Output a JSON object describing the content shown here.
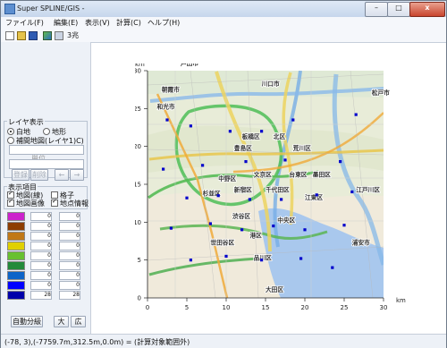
{
  "window": {
    "title": "Super SPLINE/GIS -",
    "controls": {
      "minimize": "–",
      "maximize": "□",
      "close": "x"
    }
  },
  "menu": [
    "ファイル(F)",
    "編集(E)",
    "表示(V)",
    "計算(C)",
    "ヘルプ(H)"
  ],
  "toolbar": {
    "zoom": "3兆"
  },
  "left_panel": {
    "layer_title": "レイヤ表示",
    "options": [
      "白地",
      "地形",
      "補間地図(レイヤ1)C)"
    ],
    "unit_label": "単位",
    "buttons": {
      "register": "登録",
      "delete": "削除",
      "prev": "←",
      "next": "→"
    },
    "display_title": "表示項目",
    "checkboxes": [
      "地図(線)",
      "格子",
      "地図画像",
      "地点情報"
    ],
    "legend_colors": [
      "#cc22cc",
      "#8d3d00",
      "#c07816",
      "#e0d000",
      "#68c030",
      "#238a3a",
      "#0c63c8",
      "#0000ff",
      "#0000aa"
    ],
    "legend_values": [
      "0",
      "0",
      "0",
      "0",
      "0",
      "0",
      "0",
      "0",
      "28"
    ],
    "auto_button": "自動分級",
    "small_button": "大",
    "wide_button": "広"
  },
  "chart_data": {
    "type": "scatter",
    "title": "",
    "xlabel": "km",
    "ylabel": "km",
    "xlim": [
      0,
      30
    ],
    "ylim": [
      0,
      30
    ],
    "x_ticks": [
      0,
      5,
      10,
      15,
      20,
      25,
      30
    ],
    "y_ticks": [
      0,
      5,
      10,
      15,
      20,
      25,
      30
    ],
    "grid": false,
    "points": [
      {
        "x": 2.5,
        "y": 23.5
      },
      {
        "x": 5.5,
        "y": 22.7
      },
      {
        "x": 10.5,
        "y": 22.0
      },
      {
        "x": 14.5,
        "y": 22.0
      },
      {
        "x": 18.5,
        "y": 23.5
      },
      {
        "x": 26.5,
        "y": 24.2
      },
      {
        "x": 2.0,
        "y": 17.0
      },
      {
        "x": 7.0,
        "y": 17.5
      },
      {
        "x": 12.5,
        "y": 18.0
      },
      {
        "x": 17.5,
        "y": 18.2
      },
      {
        "x": 24.5,
        "y": 18.0
      },
      {
        "x": 5.0,
        "y": 13.2
      },
      {
        "x": 9.0,
        "y": 13.5
      },
      {
        "x": 13.0,
        "y": 13.0
      },
      {
        "x": 17.0,
        "y": 13.0
      },
      {
        "x": 21.5,
        "y": 13.6
      },
      {
        "x": 26.0,
        "y": 14.0
      },
      {
        "x": 3.0,
        "y": 9.2
      },
      {
        "x": 8.0,
        "y": 9.8
      },
      {
        "x": 12.0,
        "y": 9.0
      },
      {
        "x": 16.0,
        "y": 9.5
      },
      {
        "x": 20.0,
        "y": 9.0
      },
      {
        "x": 25.0,
        "y": 9.6
      },
      {
        "x": 5.5,
        "y": 5.0
      },
      {
        "x": 10.0,
        "y": 5.5
      },
      {
        "x": 14.5,
        "y": 5.0
      },
      {
        "x": 19.5,
        "y": 5.2
      },
      {
        "x": 23.5,
        "y": 4.0
      }
    ],
    "place_labels": [
      {
        "x": 4.2,
        "y": 30.7,
        "text": "戸田市"
      },
      {
        "x": 14.5,
        "y": 28.0,
        "text": "川口市"
      },
      {
        "x": 28.5,
        "y": 26.8,
        "text": "松戸市"
      },
      {
        "x": 1.8,
        "y": 27.2,
        "text": "朝霞市"
      },
      {
        "x": 1.2,
        "y": 25.0,
        "text": "和光市"
      },
      {
        "x": 12.0,
        "y": 21.0,
        "text": "板橋区"
      },
      {
        "x": 16.0,
        "y": 21.0,
        "text": "北区"
      },
      {
        "x": 18.5,
        "y": 19.5,
        "text": "荒川区"
      },
      {
        "x": 11.0,
        "y": 19.5,
        "text": "豊島区"
      },
      {
        "x": 9.0,
        "y": 15.5,
        "text": "中野区"
      },
      {
        "x": 13.5,
        "y": 16.0,
        "text": "文京区"
      },
      {
        "x": 18.0,
        "y": 16.0,
        "text": "台東区"
      },
      {
        "x": 21.0,
        "y": 16.0,
        "text": "墨田区"
      },
      {
        "x": 7.0,
        "y": 13.5,
        "text": "杉並区"
      },
      {
        "x": 11.0,
        "y": 14.0,
        "text": "新宿区"
      },
      {
        "x": 15.0,
        "y": 14.0,
        "text": "千代田区"
      },
      {
        "x": 20.0,
        "y": 13.0,
        "text": "江東区"
      },
      {
        "x": 10.8,
        "y": 10.5,
        "text": "渋谷区"
      },
      {
        "x": 16.5,
        "y": 10.0,
        "text": "中央区"
      },
      {
        "x": 13.0,
        "y": 8.0,
        "text": "港区"
      },
      {
        "x": 8.0,
        "y": 7.0,
        "text": "世田谷区"
      },
      {
        "x": 13.5,
        "y": 5.0,
        "text": "品川区"
      },
      {
        "x": 26.5,
        "y": 14.0,
        "text": "江戸川区"
      },
      {
        "x": 26.0,
        "y": 7.0,
        "text": "浦安市"
      },
      {
        "x": 15.0,
        "y": 0.8,
        "text": "大田区"
      }
    ]
  },
  "status": {
    "text": "(-78, 3),(-7759.7m,312.5m,0.0m) = (計算対象範囲外)"
  }
}
